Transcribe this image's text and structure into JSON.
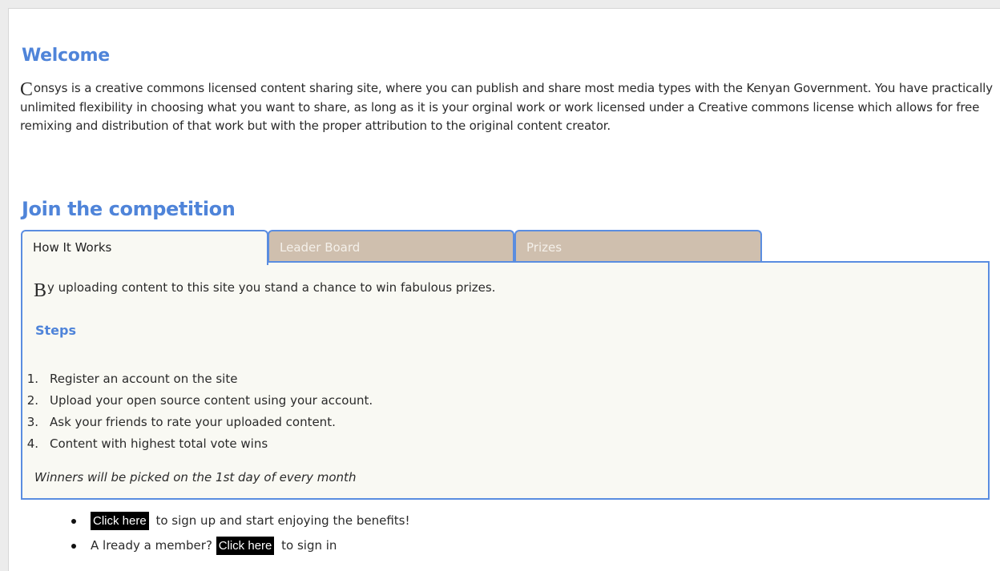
{
  "welcome": {
    "title": "Welcome",
    "dropcap": "C",
    "text": "onsys is a creative commons licensed content  sharing site, where you can publish and share most media types with the Kenyan Government. You have practically unlimited flexibility in choosing what you want to share, as long as it is your orginal work or work licensed under a Creative commons license which allows for free remixing and distribution of that work but with the proper attribution to the original content creator."
  },
  "competition": {
    "title": "Join the competition",
    "tabs": [
      {
        "label": "How It Works",
        "active": true
      },
      {
        "label": "Leader Board",
        "active": false
      },
      {
        "label": "Prizes",
        "active": false
      }
    ],
    "panel": {
      "dropcap": "B",
      "intro": "y uploading content to this site you stand a chance to win fabulous prizes.",
      "steps_title": "Steps",
      "steps": [
        {
          "num": "1.",
          "text": "Register an account on the site"
        },
        {
          "num": "2.",
          "text": "Upload your open source content using your account."
        },
        {
          "num": "3.",
          "text": "Ask your friends to rate your uploaded content."
        },
        {
          "num": "4.",
          "text": "Content with highest total vote wins"
        }
      ],
      "note": "Winners will be picked on the 1st day of every month"
    }
  },
  "actions": {
    "signup": {
      "link": "Click here",
      "text": " to sign up and start enjoying the benefits!"
    },
    "signin": {
      "prefix": "A lready a member? ",
      "link": "Click here",
      "text": " to sign in"
    }
  },
  "colors": {
    "heading": "#4f84d9",
    "tab_border": "#5a8de0",
    "tab_inactive": "#cfbfae",
    "panel_bg": "#f9f9f3"
  }
}
